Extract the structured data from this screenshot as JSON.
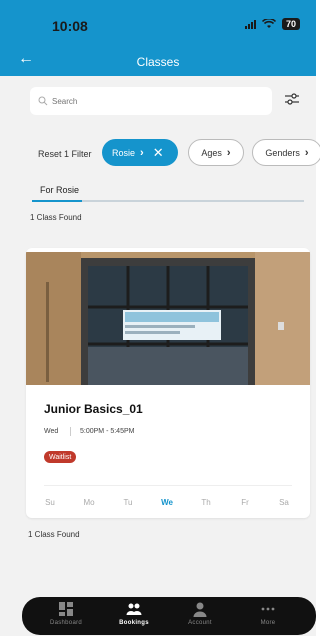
{
  "status_bar": {
    "time": "10:08",
    "battery": "70"
  },
  "header": {
    "title": "Classes"
  },
  "search": {
    "placeholder": "Search"
  },
  "filters": {
    "reset_label": "Reset 1 Filter",
    "chips": [
      {
        "label": "Rosie",
        "active": true
      },
      {
        "label": "Ages",
        "active": false
      },
      {
        "label": "Genders",
        "active": false
      }
    ]
  },
  "tabs": [
    {
      "label": "For Rosie",
      "active": true
    }
  ],
  "results": {
    "count_top": "1 Class Found",
    "count_bottom": "1 Class Found"
  },
  "class_card": {
    "name": "Junior Basics_01",
    "day": "Wed",
    "time": "5:00PM - 5:45PM",
    "badge": "Waitlist",
    "weekdays": [
      "Su",
      "Mo",
      "Tu",
      "We",
      "Th",
      "Fr",
      "Sa"
    ],
    "active_weekday": "We"
  },
  "bottom_nav": [
    {
      "label": "Dashboard",
      "icon": "dashboard-icon",
      "active": false
    },
    {
      "label": "Bookings",
      "icon": "people-icon",
      "active": true
    },
    {
      "label": "Account",
      "icon": "person-icon",
      "active": false
    },
    {
      "label": "More",
      "icon": "more-icon",
      "active": false
    }
  ],
  "colors": {
    "accent": "#1594cc",
    "badge": "#c0392b",
    "nav_bg": "#111111",
    "page_bg": "#f2f2f2"
  }
}
